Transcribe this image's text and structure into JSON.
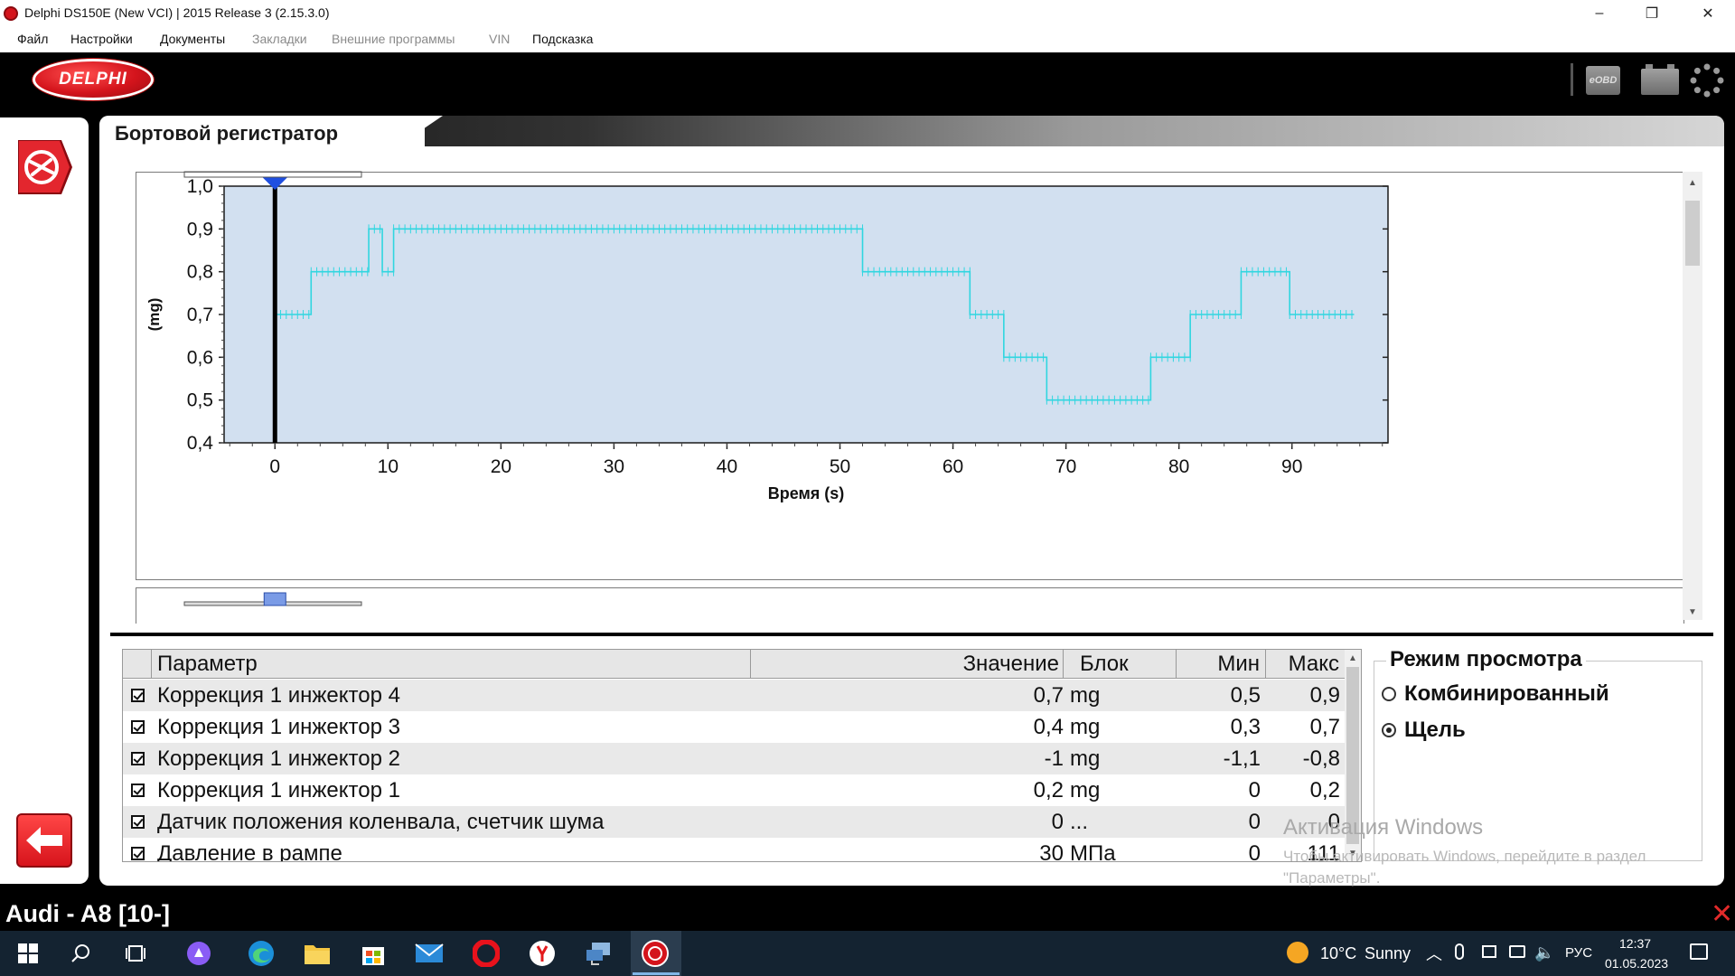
{
  "window": {
    "title": "Delphi DS150E (New VCI) | 2015 Release 3 (2.15.3.0)",
    "minimize_glyph": "–",
    "maximize_glyph": "❐",
    "close_glyph": "✕"
  },
  "menu": {
    "items": [
      {
        "label": "Файл",
        "enabled": true
      },
      {
        "label": "Настройки",
        "enabled": true
      },
      {
        "label": "Документы",
        "enabled": true
      },
      {
        "label": "Закладки",
        "enabled": false
      },
      {
        "label": "Внешние программы",
        "enabled": false
      },
      {
        "label": "VIN",
        "enabled": false
      },
      {
        "label": "Подсказка",
        "enabled": true
      }
    ]
  },
  "brand": {
    "logo_text": "DELPHI",
    "eobd_label": "eOBD",
    "icons": [
      "eobd-icon",
      "battery-icon",
      "settings-gear-icon"
    ]
  },
  "panel": {
    "title": "Бортовой регистратор"
  },
  "chart_data": {
    "type": "line",
    "title": "",
    "xlabel": "Время (s)",
    "ylabel": "(mg)",
    "xlim": [
      -4.5,
      98.5
    ],
    "ylim": [
      0.4,
      1.0
    ],
    "x_ticks": [
      0,
      10,
      20,
      30,
      40,
      50,
      60,
      70,
      80,
      90
    ],
    "y_ticks": [
      1.0,
      0.9,
      0.8,
      0.7,
      0.6,
      0.5,
      0.4
    ],
    "y_tick_labels": [
      "1,0",
      "0,9",
      "0,8",
      "0,7",
      "0,6",
      "0,5",
      "0,4"
    ],
    "grid": false,
    "line_style": "step with sample markers",
    "cursor_x": 0,
    "colors": {
      "plot_bg": "#d2e0f0",
      "series": "#30d6e0",
      "cursor": "#000000",
      "cursor_marker": "#1f4fe0"
    },
    "series": [
      {
        "steps": [
          {
            "x0": 0,
            "x1": 3.2,
            "y": 0.7
          },
          {
            "x0": 3.2,
            "x1": 8.3,
            "y": 0.8
          },
          {
            "x0": 8.3,
            "x1": 9.5,
            "y": 0.9
          },
          {
            "x0": 9.5,
            "x1": 10.5,
            "y": 0.8
          },
          {
            "x0": 10.5,
            "x1": 52.0,
            "y": 0.9
          },
          {
            "x0": 52.0,
            "x1": 61.5,
            "y": 0.8
          },
          {
            "x0": 61.5,
            "x1": 64.5,
            "y": 0.7
          },
          {
            "x0": 64.5,
            "x1": 68.3,
            "y": 0.6
          },
          {
            "x0": 68.3,
            "x1": 77.5,
            "y": 0.5
          },
          {
            "x0": 77.5,
            "x1": 81.0,
            "y": 0.6
          },
          {
            "x0": 81.0,
            "x1": 85.5,
            "y": 0.7
          },
          {
            "x0": 85.5,
            "x1": 89.8,
            "y": 0.8
          },
          {
            "x0": 89.8,
            "x1": 95.5,
            "y": 0.7
          }
        ]
      }
    ]
  },
  "table": {
    "headers": {
      "param": "Параметр",
      "value": "Значение",
      "unit": "Блок",
      "min": "Мин",
      "max": "Макс"
    },
    "rows": [
      {
        "checked": true,
        "param": "Коррекция 1 инжектор 4",
        "value": "0,7",
        "unit": "mg",
        "min": "0,5",
        "max": "0,9"
      },
      {
        "checked": true,
        "param": "Коррекция 1 инжектор 3",
        "value": "0,4",
        "unit": "mg",
        "min": "0,3",
        "max": "0,7"
      },
      {
        "checked": true,
        "param": "Коррекция 1 инжектор 2",
        "value": "-1",
        "unit": "mg",
        "min": "-1,1",
        "max": "-0,8"
      },
      {
        "checked": true,
        "param": "Коррекция 1 инжектор 1",
        "value": "0,2",
        "unit": "mg",
        "min": "0",
        "max": "0,2"
      },
      {
        "checked": true,
        "param": "Датчик положения коленвала, счетчик шума",
        "value": "0",
        "unit": "...",
        "min": "0",
        "max": "0"
      },
      {
        "checked": true,
        "param": "Давление в рампе",
        "value": "30",
        "unit": "МПа",
        "min": "0",
        "max": "111"
      }
    ]
  },
  "view_mode": {
    "title": "Режим просмотра",
    "options": [
      {
        "label": "Комбинированный",
        "selected": false
      },
      {
        "label": "Щель",
        "selected": true
      }
    ]
  },
  "watermark": {
    "line1": "Активация Windows",
    "line2": "Чтобы активировать Windows, перейдите в раздел",
    "line3": "\"Параметры\"."
  },
  "status": {
    "vehicle": "Audi - A8 [10-]"
  },
  "taskbar": {
    "apps": [
      "windows-start-icon",
      "search-icon",
      "task-view-icon",
      "cortana-icon",
      "edge-icon",
      "file-explorer-icon",
      "store-icon",
      "mail-icon",
      "opera-icon",
      "yandex-icon",
      "network-app-icon",
      "delphi-app-icon"
    ],
    "weather": {
      "temp": "10°C",
      "condition": "Sunny"
    },
    "lang": "РУС",
    "time": "12:37",
    "date": "01.05.2023"
  }
}
